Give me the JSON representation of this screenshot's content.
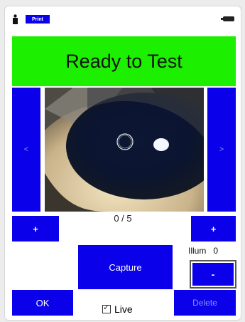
{
  "topbar": {
    "print_label": "Print"
  },
  "banner": {
    "status_text": "Ready to Test"
  },
  "nav": {
    "prev_label": "<",
    "next_label": ">"
  },
  "counter": {
    "text": "0 / 5"
  },
  "buttons": {
    "plus_left": "+",
    "plus_right": "+",
    "capture": "Capture",
    "minus": "-",
    "ok": "OK",
    "delete": "Delete"
  },
  "illum": {
    "label": "Illum",
    "value": "0"
  },
  "live": {
    "label": "Live",
    "checked": true
  },
  "colors": {
    "banner_green": "#1cf000",
    "button_blue": "#0a00ea",
    "disabled_text": "#8f8fff"
  }
}
